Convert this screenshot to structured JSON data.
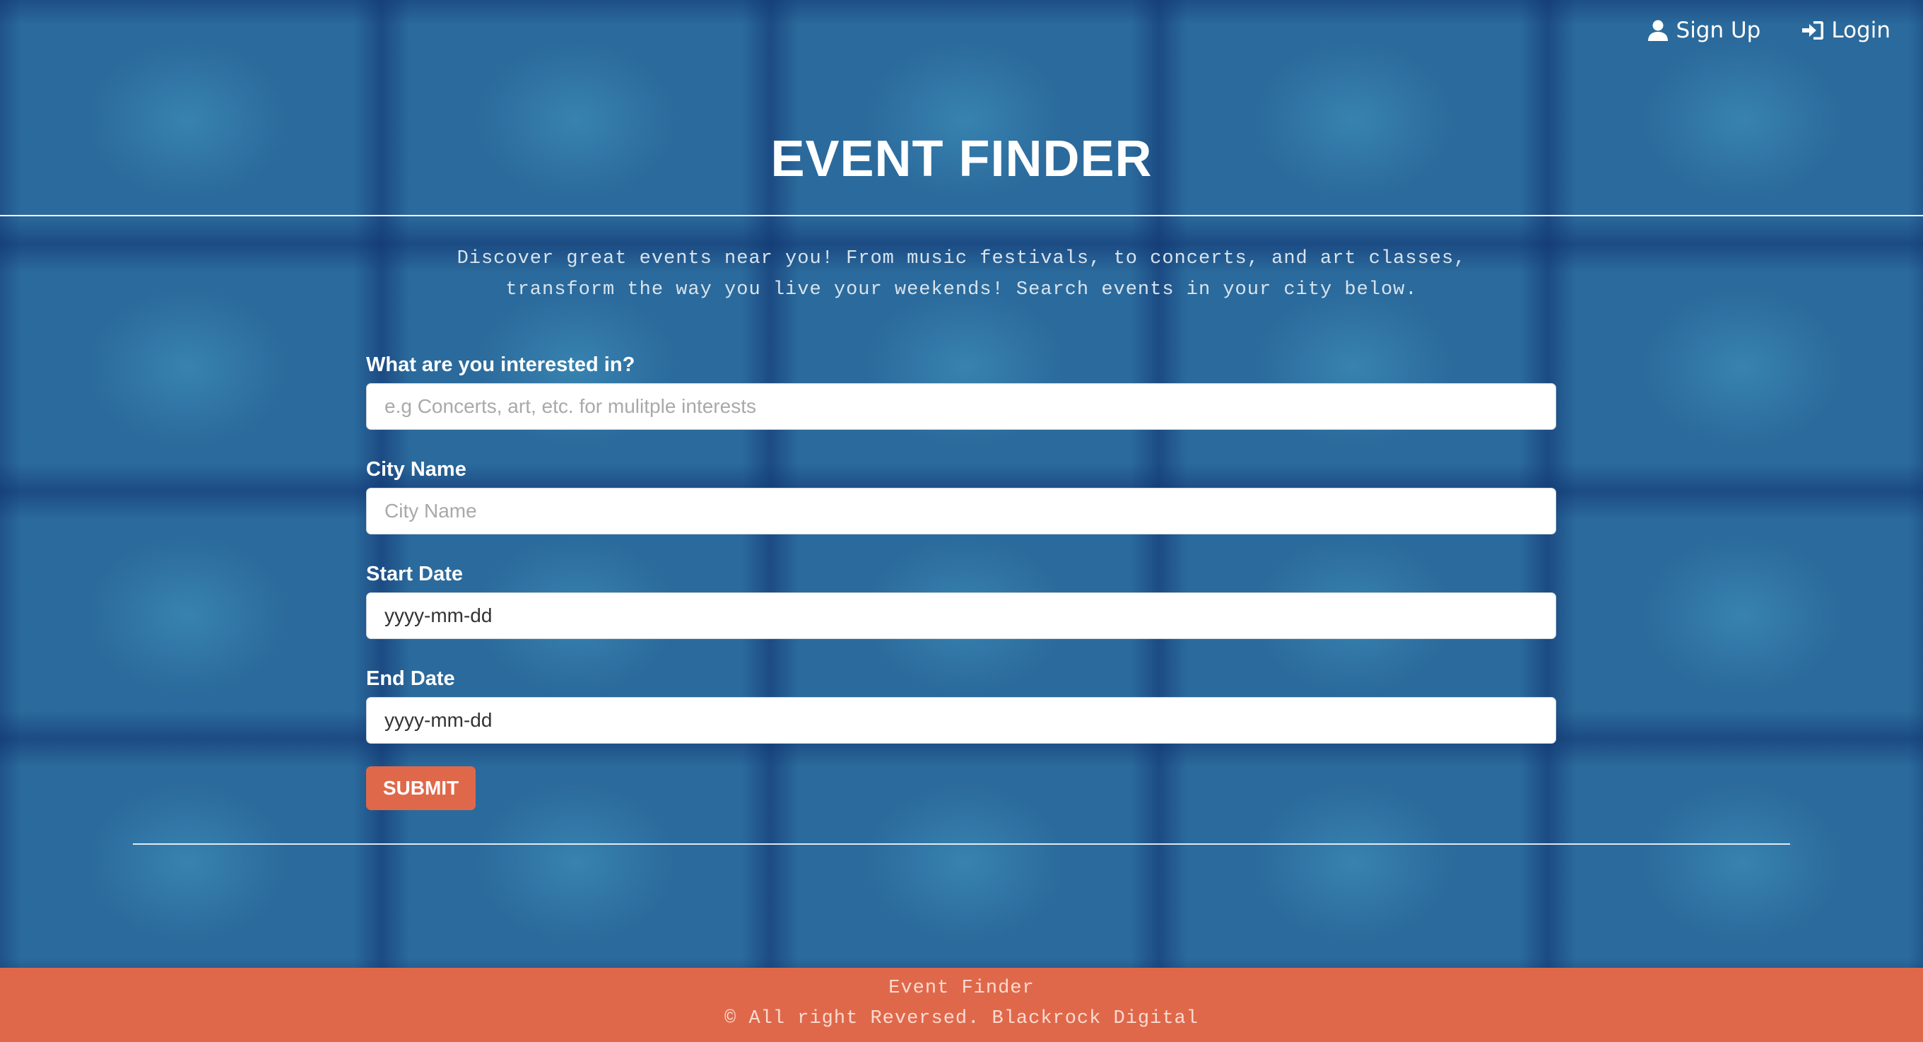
{
  "nav": {
    "signup_label": "Sign Up",
    "login_label": "Login"
  },
  "header": {
    "title": "EVENT FINDER"
  },
  "intro": {
    "line1": "Discover great events near you! From music festivals, to concerts, and art classes,",
    "line2": "transform the way you live your weekends! Search events in your city below."
  },
  "form": {
    "interest": {
      "label": "What are you interested in?",
      "placeholder": "e.g Concerts, art, etc. for mulitple interests",
      "value": ""
    },
    "city": {
      "label": "City Name",
      "placeholder": "City Name",
      "value": ""
    },
    "start_date": {
      "label": "Start Date",
      "placeholder": "yyyy-mm-dd",
      "value": ""
    },
    "end_date": {
      "label": "End Date",
      "placeholder": "yyyy-mm-dd",
      "value": ""
    },
    "submit_label": "SUBMIT"
  },
  "footer": {
    "name": "Event Finder",
    "copyright": "© All right Reversed. Blackrock Digital"
  },
  "colors": {
    "background": "#2b6a9c",
    "accent": "#e0684a"
  },
  "icons": {
    "signup": "user-icon",
    "login": "sign-in-icon"
  }
}
